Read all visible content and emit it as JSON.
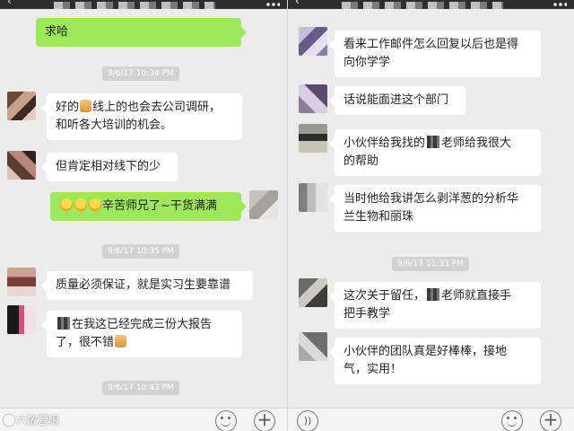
{
  "left": {
    "messages": {
      "top_out": "求哈",
      "m1": "好的👌线上的也会去公司调研，和听各大培训的机会。",
      "m1_line1": "好的",
      "m1_line1b": "线上的也会去公司调研，",
      "m1_line2": "和听各大培训的机会。",
      "m2": "但肯定相对线下的少",
      "m3": "辛苦师兄了~干货满满",
      "m4": "质量必须保证，就是实习生要靠谱",
      "m5_line1": "在我这已经完成三份大报告",
      "m5_line2": "了，很不错"
    },
    "timestamps": [
      "9/6/17 10:34 PM",
      "9/6/17 10:35 PM",
      "9/6/17 10:43 PM"
    ]
  },
  "right": {
    "messages": {
      "r1_line1": "看来工作邮件怎么回复以后也是得",
      "r1_line2": "向你学学",
      "r2": "话说能面进这个部门",
      "r3_line1a": "小伙伴给我找的",
      "r3_line1b": "老师给我很大",
      "r3_line2": "的帮助",
      "r4_line1": "当时他给我讲怎么剥洋葱的分析华",
      "r4_line2": "兰生物和丽珠",
      "r5_line1a": "这次关于留任，",
      "r5_line1b": "老师就直接手",
      "r5_line2": "把手教学",
      "r6_line1": "小伙伴的团队真是好棒棒，接地",
      "r6_line2": "气，实用！"
    },
    "timestamps": [
      "9/6/17 11:33 PM"
    ]
  },
  "inputbar": {
    "voice_glyph": "))",
    "plus_glyph": "+"
  },
  "watermark": {
    "text": "六散营眼"
  },
  "icons": [
    "back-icon",
    "more-icon",
    "emoji-icon",
    "plus-icon",
    "voice-icon"
  ]
}
